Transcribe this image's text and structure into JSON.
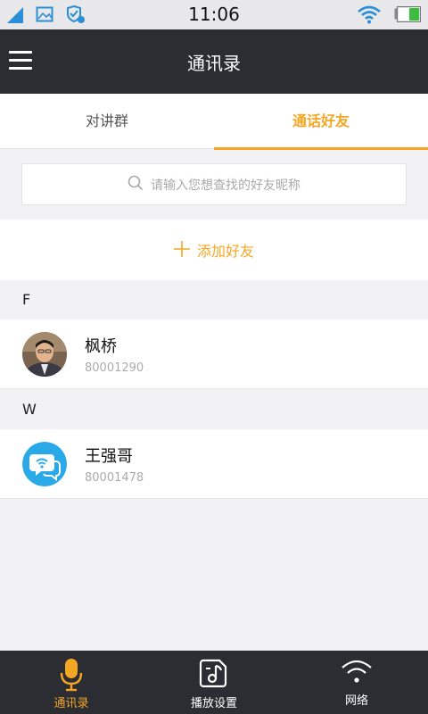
{
  "status_bar": {
    "time": "11:06",
    "left_icons": [
      "signal-icon",
      "image-icon",
      "shield-icon"
    ],
    "right_icons": [
      "wifi-icon",
      "battery-icon"
    ]
  },
  "header": {
    "title": "通讯录",
    "menu_icon": "menu-icon"
  },
  "tabs": [
    {
      "label": "对讲群",
      "active": false
    },
    {
      "label": "通话好友",
      "active": true
    }
  ],
  "search": {
    "placeholder": "请输入您想查找的好友昵称",
    "icon": "search-icon"
  },
  "add_friend": {
    "label": "添加好友",
    "icon": "plus-icon"
  },
  "sections": [
    {
      "letter": "F",
      "contacts": [
        {
          "name": "枫桥",
          "number": "80001290",
          "avatar": "photo-avatar"
        }
      ]
    },
    {
      "letter": "W",
      "contacts": [
        {
          "name": "王强哥",
          "number": "80001478",
          "avatar": "chat-wifi-avatar"
        }
      ]
    }
  ],
  "bottom_nav": [
    {
      "label": "通讯录",
      "icon": "microphone-icon",
      "active": true
    },
    {
      "label": "播放设置",
      "icon": "music-note-icon",
      "active": false
    },
    {
      "label": "网络",
      "icon": "wifi-icon",
      "active": false
    }
  ],
  "colors": {
    "accent": "#f5a623",
    "header_bg": "#2b2d33",
    "page_bg": "#f2f2f4",
    "avatar_blue": "#29a9e8"
  }
}
